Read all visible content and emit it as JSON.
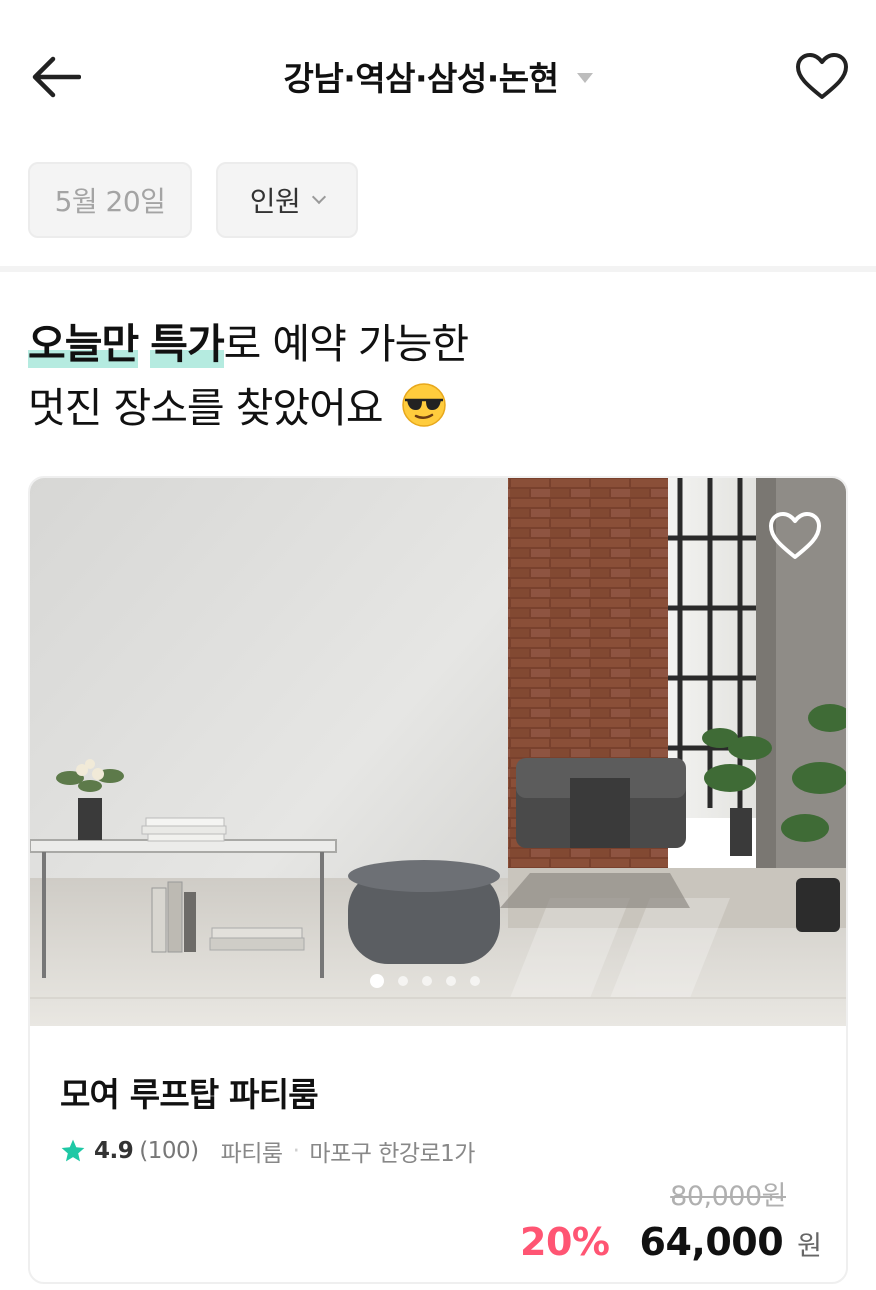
{
  "header": {
    "location": "강남·역삼·삼성·논현"
  },
  "filters": {
    "date": "5월 20일",
    "people": "인원"
  },
  "headline": {
    "highlight1": "오늘만",
    "highlight2": "특가",
    "rest_line1": "로 예약 가능한",
    "line2": "멋진 장소를 찾았어요"
  },
  "listing": {
    "name": "모여 루프탑 파티룸",
    "rating": "4.9",
    "reviews": "(100)",
    "category": "파티룸",
    "address": "마포구 한강로1가",
    "original_price": "80,000원",
    "discount": "20%",
    "price": "64,000",
    "currency": "원",
    "slides": 5,
    "active_slide": 1
  },
  "colors": {
    "accent_mint": "#b5ebe0",
    "star": "#1ec8a5",
    "discount": "#ff5573"
  },
  "icons": [
    "back-arrow-icon",
    "heart-icon",
    "caret-down-icon",
    "chevron-down-icon",
    "sunglasses-emoji-icon",
    "star-icon"
  ]
}
